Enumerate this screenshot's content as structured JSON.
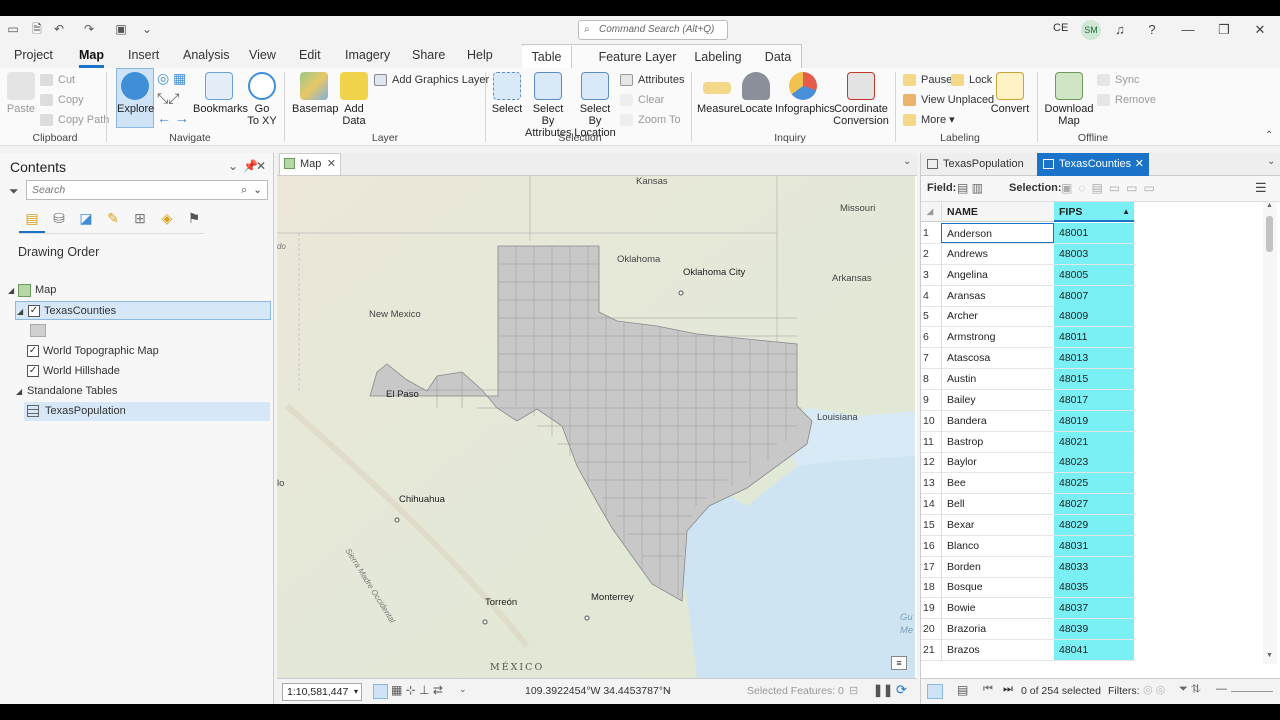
{
  "titlebar": {
    "search_placeholder": "Command Search (Alt+Q)",
    "user_initials": "CE",
    "avatar": "SM"
  },
  "tabs": [
    "Project",
    "Map",
    "Insert",
    "Analysis",
    "View",
    "Edit",
    "Imagery",
    "Share",
    "Help"
  ],
  "active_tab": "Map",
  "context_tabs": {
    "Table": "Table",
    "FeatureLayer": "Feature Layer",
    "Labeling": "Labeling",
    "Data": "Data"
  },
  "ribbon": {
    "clipboard": {
      "paste": "Paste",
      "cut": "Cut",
      "copy": "Copy",
      "copy_path": "Copy Path",
      "label": "Clipboard"
    },
    "navigate": {
      "explore": "Explore",
      "bookmarks": "Bookmarks",
      "goto": "Go",
      "goto2": "To XY",
      "label": "Navigate"
    },
    "layer": {
      "basemap": "Basemap",
      "add_data": "Add",
      "add_data2": "Data",
      "add_graphics": "Add Graphics Layer",
      "label": "Layer"
    },
    "selection": {
      "select": "Select",
      "by_attr": "Select By",
      "by_attr2": "Attributes",
      "by_loc": "Select By",
      "by_loc2": "Location",
      "attributes": "Attributes",
      "clear": "Clear",
      "zoom_to": "Zoom To",
      "label": "Selection"
    },
    "inquiry": {
      "measure": "Measure",
      "locate": "Locate",
      "infographics": "Infographics",
      "coord": "Coordinate",
      "coord2": "Conversion",
      "label": "Inquiry"
    },
    "labeling": {
      "pause": "Pause",
      "lock": "Lock",
      "view_unplaced": "View Unplaced",
      "more": "More",
      "convert": "Convert",
      "label": "Labeling"
    },
    "offline": {
      "download": "Download",
      "download2": "Map",
      "sync": "Sync",
      "remove": "Remove",
      "label": "Offline"
    }
  },
  "contents": {
    "title": "Contents",
    "search_placeholder": "Search",
    "drawing_order": "Drawing Order",
    "map_node": "Map",
    "layers": [
      "TexasCounties",
      "World Topographic Map",
      "World Hillshade"
    ],
    "standalone": "Standalone Tables",
    "table_item": "TexasPopulation"
  },
  "map": {
    "tab_label": "Map",
    "labels": {
      "kansas": "Kansas",
      "missouri": "Missouri",
      "oklahoma": "Oklahoma",
      "okc": "Oklahoma City",
      "arkansas": "Arkansas",
      "newmexico": "New Mexico",
      "elpaso": "El Paso",
      "louisiana": "Louisiana",
      "chihuahua": "Chihuahua",
      "torreon": "Torreón",
      "monterrey": "Monterrey",
      "mexico": "MÉXICO",
      "sierra": "Sierra Madre Occidental",
      "do": "do",
      "lo": "lo",
      "gu": "Gu",
      "me": "Me"
    },
    "scale": "1:10,581,447",
    "coords": "109.3922454°W 34.4453787°N",
    "selected_features": "Selected Features: 0"
  },
  "table": {
    "tabs": [
      "TexasPopulation",
      "TexasCounties"
    ],
    "active": "TexasCounties",
    "field_label": "Field:",
    "selection_label": "Selection:",
    "columns": [
      "NAME",
      "FIPS"
    ],
    "rows": [
      [
        "1",
        "Anderson",
        "48001"
      ],
      [
        "2",
        "Andrews",
        "48003"
      ],
      [
        "3",
        "Angelina",
        "48005"
      ],
      [
        "4",
        "Aransas",
        "48007"
      ],
      [
        "5",
        "Archer",
        "48009"
      ],
      [
        "6",
        "Armstrong",
        "48011"
      ],
      [
        "7",
        "Atascosa",
        "48013"
      ],
      [
        "8",
        "Austin",
        "48015"
      ],
      [
        "9",
        "Bailey",
        "48017"
      ],
      [
        "10",
        "Bandera",
        "48019"
      ],
      [
        "11",
        "Bastrop",
        "48021"
      ],
      [
        "12",
        "Baylor",
        "48023"
      ],
      [
        "13",
        "Bee",
        "48025"
      ],
      [
        "14",
        "Bell",
        "48027"
      ],
      [
        "15",
        "Bexar",
        "48029"
      ],
      [
        "16",
        "Blanco",
        "48031"
      ],
      [
        "17",
        "Borden",
        "48033"
      ],
      [
        "18",
        "Bosque",
        "48035"
      ],
      [
        "19",
        "Bowie",
        "48037"
      ],
      [
        "20",
        "Brazoria",
        "48039"
      ],
      [
        "21",
        "Brazos",
        "48041"
      ]
    ],
    "selected_status": "0 of 254 selected",
    "filters_label": "Filters:"
  }
}
